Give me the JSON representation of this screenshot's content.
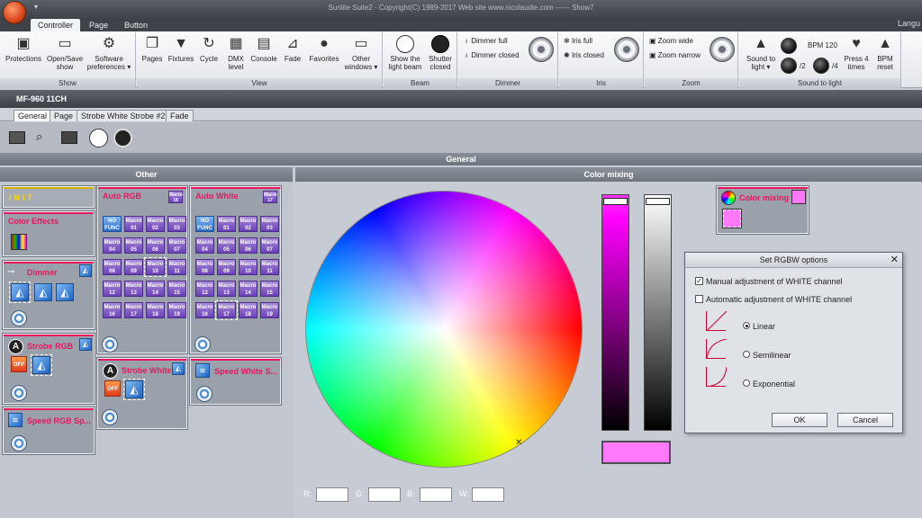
{
  "titlebar": {
    "title": "Sunlite Suite2 - Copyright(C) 1989-2017    Web site www.nicolaudie.com ------ Show7"
  },
  "tabs": [
    {
      "label": "Controller"
    },
    {
      "label": "Page"
    },
    {
      "label": "Button"
    }
  ],
  "lang_label": "Langu",
  "ribbon": {
    "show": {
      "label": "Show",
      "buttons": [
        "Protections",
        "Open/Save show",
        "Software preferences ▾"
      ]
    },
    "view": {
      "label": "View",
      "buttons": [
        "Pages",
        "Fixtures",
        "Cycle",
        "DMX level",
        "Console",
        "Fade",
        "Favorites",
        "Other windows ▾"
      ]
    },
    "beam": {
      "label": "Beam",
      "buttons": [
        "Show the light beam",
        "Shutter closed"
      ]
    },
    "dimmer": {
      "label": "Dimmer",
      "full": "Dimmer full",
      "closed": "Dimmer closed"
    },
    "iris": {
      "label": "Iris",
      "full": "Iris full",
      "closed": "Iris closed"
    },
    "zoom": {
      "label": "Zoom",
      "wide": "Zoom wide",
      "narrow": "Zoom narrow"
    },
    "sound": {
      "label": "Sound to light",
      "sound_to_light": "Sound to light ▾",
      "bpm": "BPM 120",
      "div2": "/2",
      "div4": "/4",
      "press4": "Press 4 times",
      "bpm_reset": "BPM reset"
    }
  },
  "fixture": {
    "name": "MF-960 11CH"
  },
  "subtabs": [
    "General",
    "Page",
    "Strobe White Strobe #2",
    "Fade"
  ],
  "general_label": "General",
  "other": {
    "label": "Other",
    "init": "INIT",
    "color_effects": "Color Effects",
    "dimmer": "Dimmer",
    "strobe_rgb": "Strobe RGB",
    "speed_rgb": "Speed RGB Sp...",
    "auto_rgb": "Auto RGB",
    "auto_white": "Auto White",
    "strobe_white": "Strobe White",
    "speed_white": "Speed White S...",
    "macro_badge": "Macro 18",
    "macro_badge2": "Macro 17",
    "no_func": "NO FUNC",
    "macros_rgb": [
      "01",
      "02",
      "03",
      "04",
      "05",
      "06",
      "07",
      "08",
      "09",
      "10",
      "11",
      "12",
      "13",
      "14",
      "15",
      "16",
      "17",
      "18",
      "19"
    ],
    "macros_white": [
      "01",
      "02",
      "03",
      "04",
      "05",
      "06",
      "07",
      "08",
      "09",
      "10",
      "11",
      "12",
      "13",
      "14",
      "15",
      "16",
      "17",
      "18",
      "19"
    ],
    "off": "OFF"
  },
  "color_mixing": {
    "label": "Color mixing",
    "badge": "Color mixing",
    "r_label": "R:",
    "g_label": "G:",
    "b_label": "B:",
    "w_label": "W:",
    "r": "",
    "g": "",
    "b": "",
    "w": "",
    "swatch": "#ff79fa"
  },
  "dialog": {
    "title": "Set RGBW options",
    "manual": "Manual adjustment of WHITE channel",
    "automatic": "Automatic adjustment of WHITE channel",
    "linear": "Linear",
    "semilinear": "Semilinear",
    "exponential": "Exponential",
    "ok": "OK",
    "cancel": "Cancel"
  }
}
